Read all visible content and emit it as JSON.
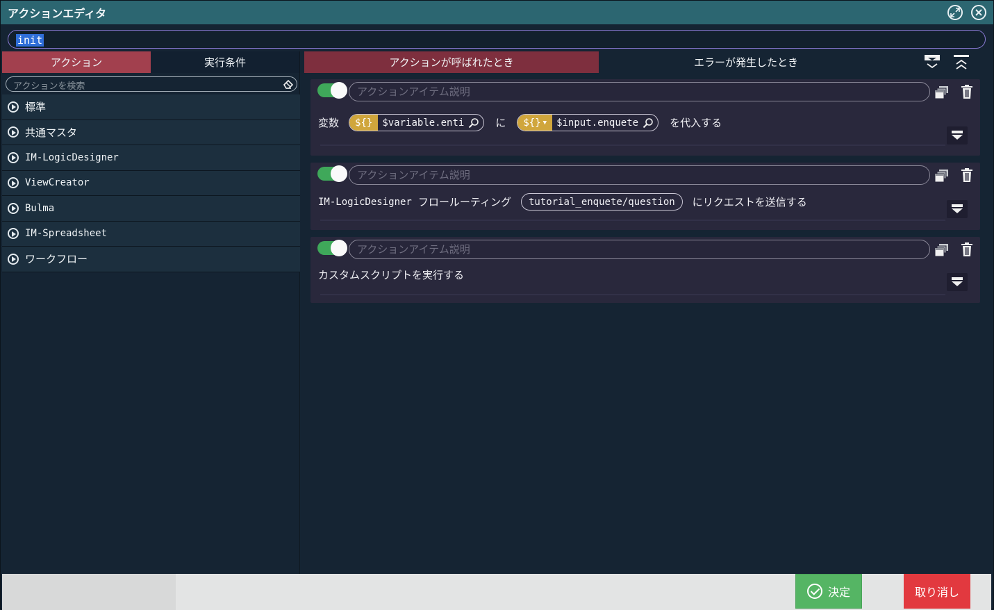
{
  "window": {
    "title": "アクションエディタ",
    "restore_icon": "restore-icon",
    "close_icon": "close-icon"
  },
  "action_name": {
    "value": "init"
  },
  "left_panel": {
    "tabs": [
      {
        "label": "アクション",
        "active": true
      },
      {
        "label": "実行条件",
        "active": false
      }
    ],
    "search_placeholder": "アクションを検索",
    "categories": [
      {
        "label": "標準"
      },
      {
        "label": "共通マスタ"
      },
      {
        "label": "IM-LogicDesigner"
      },
      {
        "label": "ViewCreator"
      },
      {
        "label": "Bulma"
      },
      {
        "label": "IM-Spreadsheet"
      },
      {
        "label": "ワークフロー"
      }
    ]
  },
  "right_panel": {
    "tabs": [
      {
        "label": "アクションが呼ばれたとき",
        "active": true
      },
      {
        "label": "エラーが発生したとき",
        "active": false
      }
    ],
    "description_placeholder": "アクションアイテム説明",
    "items": [
      {
        "enabled": true,
        "label_prefix": "変数",
        "left_template": "${}",
        "left_value": "$variable.enti",
        "connector": "に",
        "right_template": "${}",
        "right_value": "$input.enquete",
        "label_suffix": "を代入する"
      },
      {
        "enabled": true,
        "prefix": "IM-LogicDesigner",
        "label": "フロールーティング",
        "route": "tutorial_enquete/question",
        "suffix": "にリクエストを送信する"
      },
      {
        "enabled": true,
        "label": "カスタムスクリプトを実行する"
      }
    ]
  },
  "footer": {
    "ok_label": "決定",
    "cancel_label": "取り消し"
  },
  "colors": {
    "titlebar": "#2c6671",
    "active_left_tab": "#a2404e",
    "active_right_tab": "#7e2f3e",
    "toggle_on": "#3fa85a",
    "template_badge": "#d0a63c",
    "ok": "#55b564",
    "cancel": "#e2393f"
  }
}
